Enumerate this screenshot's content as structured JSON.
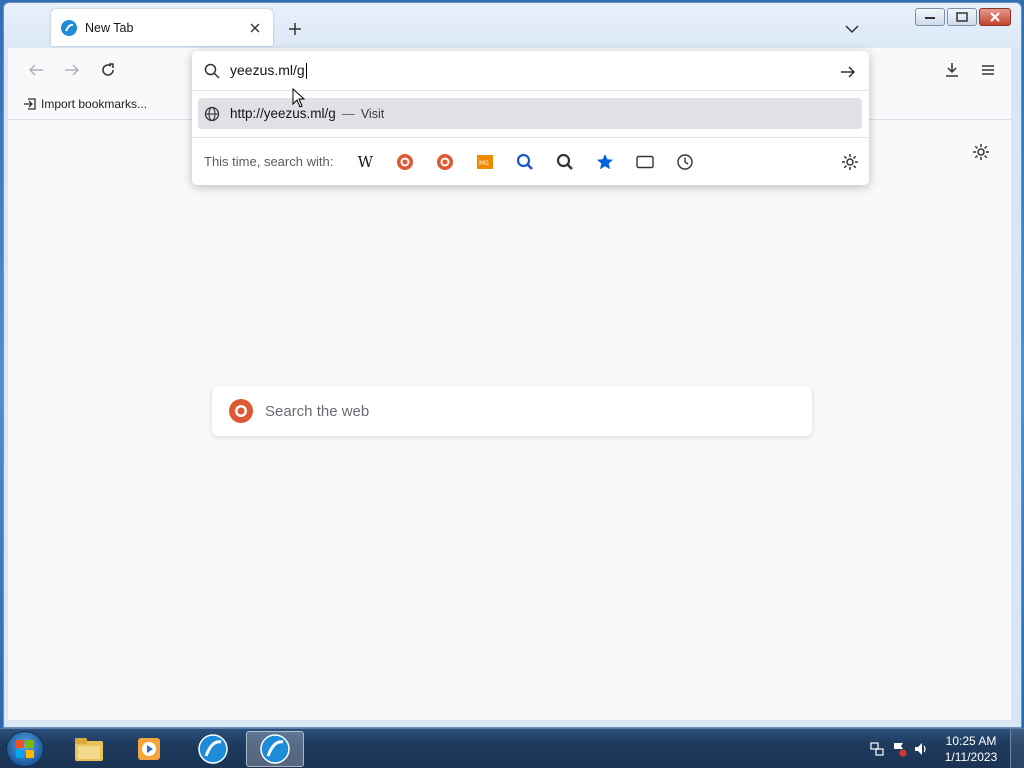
{
  "tab": {
    "title": "New Tab"
  },
  "urlbar": {
    "value": "yeezus.ml/g",
    "suggestion": {
      "url": "http://yeezus.ml/g",
      "separator": "—",
      "action": "Visit"
    },
    "oneoff_label": "This time, search with:",
    "engines": [
      "wikipedia-icon",
      "duckduckgo-icon",
      "duckduckgo-icon",
      "metager-icon",
      "search-icon",
      "search-icon",
      "bookmarks-icon",
      "tabs-icon",
      "history-icon"
    ]
  },
  "bookmarks": {
    "import_label": "Import bookmarks..."
  },
  "page": {
    "search_placeholder": "Search the web"
  },
  "taskbar": {
    "time": "10:25 AM",
    "date": "1/11/2023"
  },
  "colors": {
    "accent": "#0060df",
    "ddg": "#de5833",
    "metager": "#f08a00"
  }
}
